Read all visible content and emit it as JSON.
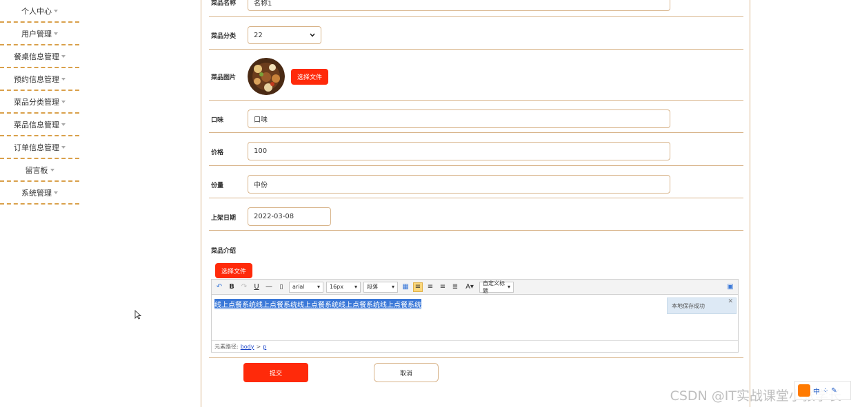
{
  "sidebar": {
    "items": [
      {
        "label": "个人中心"
      },
      {
        "label": "用户管理"
      },
      {
        "label": "餐桌信息管理"
      },
      {
        "label": "预约信息管理"
      },
      {
        "label": "菜品分类管理"
      },
      {
        "label": "菜品信息管理"
      },
      {
        "label": "订单信息管理"
      },
      {
        "label": "留言板"
      },
      {
        "label": "系统管理"
      }
    ]
  },
  "form": {
    "name": {
      "label": "菜品名称",
      "value": "名称1"
    },
    "category": {
      "label": "菜品分类",
      "value": "22"
    },
    "image": {
      "label": "菜品图片",
      "button": "选择文件"
    },
    "taste": {
      "label": "口味",
      "value": "口味"
    },
    "price": {
      "label": "价格",
      "value": "100"
    },
    "portion": {
      "label": "份量",
      "value": "中份"
    },
    "date": {
      "label": "上架日期",
      "value": "2022-03-08"
    },
    "intro": {
      "label": "菜品介绍",
      "button": "选择文件"
    }
  },
  "editor": {
    "toolbar": {
      "font": "arial",
      "size": "16px",
      "paragraph": "段落",
      "custom_title": "自定义标题"
    },
    "content": "线上点餐系统线上点餐系统线上点餐系统线上点餐系统线上点餐系统",
    "toast": "本地保存成功",
    "path_label": "元素路径:",
    "path_body": "body",
    "path_sep": ">",
    "path_p": "p"
  },
  "actions": {
    "submit": "提交",
    "cancel": "取消"
  },
  "watermark": "CSDN @IT实战课堂小张学长",
  "ime": {
    "label": "中"
  },
  "colors": {
    "accent_red": "#ff2a0a",
    "border": "#d8b48a",
    "dash": "#d9a04a"
  }
}
